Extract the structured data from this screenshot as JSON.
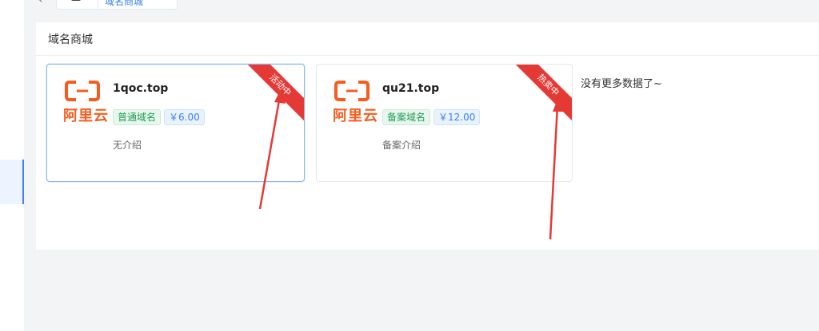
{
  "topbar": {
    "nav_label": "域名商城"
  },
  "panel": {
    "title": "域名商城"
  },
  "cards": [
    {
      "provider": "阿里云",
      "domain": "1qoc.top",
      "type_tag": "普通域名",
      "price_tag": "￥6.00",
      "desc": "无介绍",
      "ribbon": "活动中"
    },
    {
      "provider": "阿里云",
      "domain": "qu21.top",
      "type_tag": "备案域名",
      "price_tag": "￥12.00",
      "desc": "备案介绍",
      "ribbon": "热卖中"
    }
  ],
  "list_end": "没有更多数据了~",
  "colors": {
    "ribbon": "#e53935",
    "accent": "#3b82f6",
    "brand": "#f55d1f",
    "arrow": "#e53935"
  }
}
